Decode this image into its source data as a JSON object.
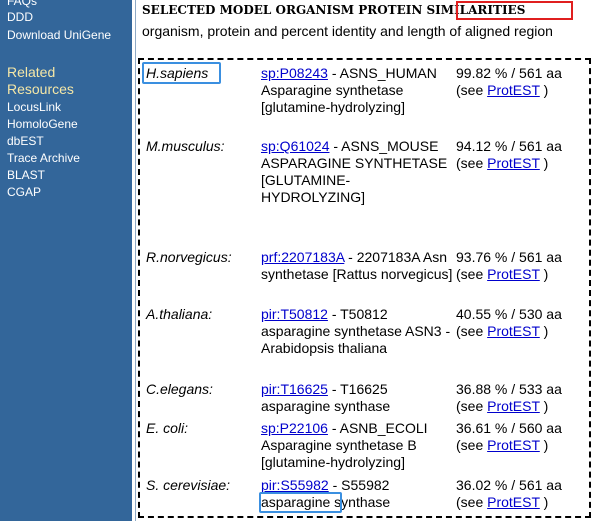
{
  "sidebar": {
    "links_top": [
      "FAQs",
      "DDD",
      "Download UniGene"
    ],
    "related_heading": "Related Resources",
    "related_links": [
      "LocusLink",
      "HomoloGene",
      "dbEST",
      "Trace Archive",
      "BLAST",
      "CGAP"
    ]
  },
  "section": {
    "title_prefix": "SELECTED MODEL ORGANISM PROTEIN",
    "title_highlight": "SIMILARITIES",
    "subtitle": "organism, protein and percent identity and length of aligned region"
  },
  "rows": [
    {
      "organism": "H.sapiens",
      "accession": "sp:P08243",
      "desc_after": " - ASNS_HUMAN Asparagine synthetase [glutamine-hydrolyzing]",
      "stats": "99.82 % / 561 aa",
      "see_prefix": "(see ",
      "link": "ProtEST",
      "see_suffix": " )"
    },
    {
      "organism": "M.musculus:",
      "accession": "sp:Q61024",
      "desc_after": " - ASNS_MOUSE ASPARAGINE SYNTHETASE [GLUTAMINE-HYDROLYZING]",
      "stats": "94.12 % / 561 aa",
      "see_prefix": "(see ",
      "link": "ProtEST",
      "see_suffix": " )"
    },
    {
      "organism": "R.norvegicus:",
      "accession": "prf:2207183A",
      "desc_after": " - 2207183A Asn synthetase [Rattus norvegicus]",
      "stats": "93.76 % / 561 aa",
      "see_prefix": "(see ",
      "link": "ProtEST",
      "see_suffix": " )"
    },
    {
      "organism": "A.thaliana:",
      "accession": "pir:T50812",
      "desc_after": " - T50812 asparagine synthetase ASN3 - Arabidopsis thaliana",
      "stats": "40.55 % / 530 aa",
      "see_prefix": "(see ",
      "link": "ProtEST",
      "see_suffix": " )"
    },
    {
      "organism": "C.elegans:",
      "accession": "pir:T16625",
      "desc_after": " - T16625 asparagine synthase",
      "stats": "36.88 % / 533 aa",
      "see_prefix": "(see ",
      "link": "ProtEST",
      "see_suffix": " )"
    },
    {
      "organism": "E. coli:",
      "accession": "sp:P22106",
      "desc_after": " - ASNB_ECOLI Asparagine synthetase B [glutamine-hydrolyzing]",
      "stats": "36.61 % / 560 aa",
      "see_prefix": "(see ",
      "link": "ProtEST",
      "see_suffix": " )"
    },
    {
      "organism": "S. cerevisiae:",
      "accession": "pir:S55982",
      "desc_after": " - S55982",
      "desc_highlight": "asparagine",
      "desc_tail": " synthase",
      "stats": "36.02 % / 561 aa",
      "see_prefix": "(see ",
      "link": "ProtEST",
      "see_suffix": " )"
    }
  ],
  "colors": {
    "sidebar_bg": "#33669a",
    "heading": "#f4e7a7",
    "link": "#0000cc",
    "highlight_red": "#e01f1f",
    "highlight_blue": "#3a8fe0"
  }
}
